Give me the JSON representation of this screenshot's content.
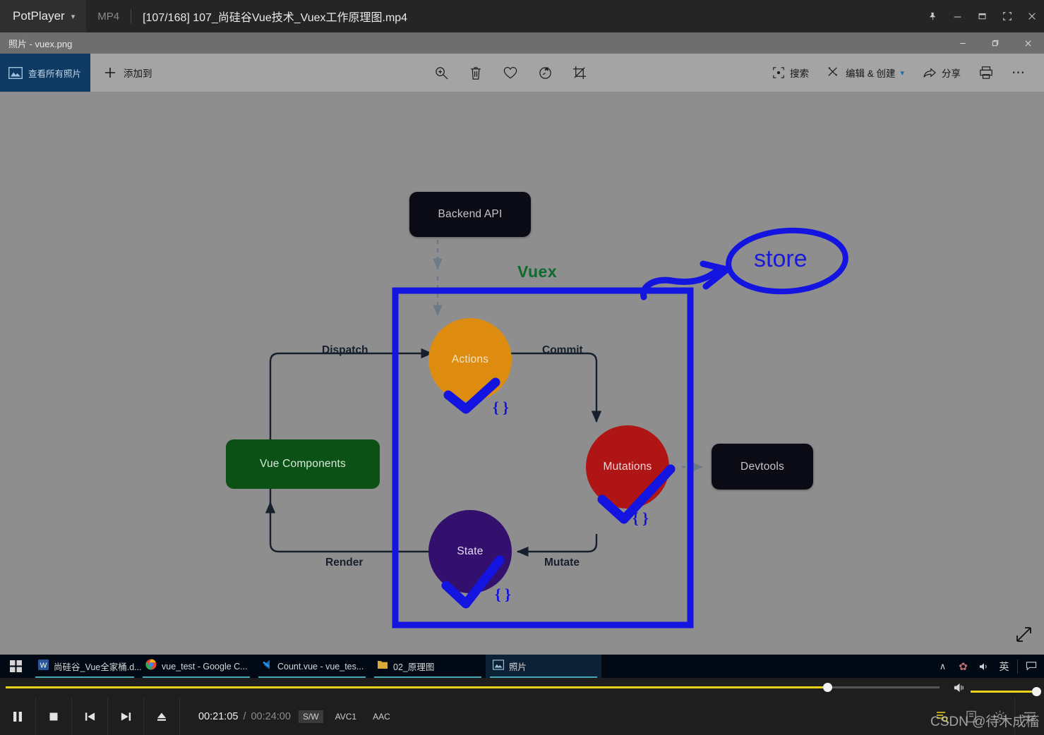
{
  "player": {
    "app_name": "PotPlayer",
    "dropdown_icon": "chevron-down-icon",
    "format": "MP4",
    "file_title": "[107/168] 107_尚硅谷Vue技术_Vuex工作原理图.mp4",
    "window_buttons": [
      {
        "name": "pin-icon",
        "label": "Pin"
      },
      {
        "name": "minimize-icon",
        "label": "Minimize"
      },
      {
        "name": "maximize-icon",
        "label": "Maximize"
      },
      {
        "name": "fullscreen-icon",
        "label": "Fullscreen"
      },
      {
        "name": "close-icon",
        "label": "Close"
      }
    ]
  },
  "photos": {
    "title": "照片 - vuex.png",
    "window_buttons": [
      {
        "name": "minimize-icon",
        "label": "Minimize"
      },
      {
        "name": "restore-icon",
        "label": "Restore"
      },
      {
        "name": "close-icon",
        "label": "Close"
      }
    ],
    "toolbar": {
      "view_all_label": "查看所有照片",
      "view_all_icon": "photo-icon",
      "add_to_label": "添加到",
      "add_to_icon": "plus-icon",
      "center_icons": [
        "zoom-in-icon",
        "delete-icon",
        "heart-icon",
        "rotate-icon",
        "crop-icon"
      ],
      "search_label": "搜索",
      "search_icon": "search-icon",
      "edit_create_label": "编辑 & 创建",
      "edit_create_icon": "edit-icon",
      "edit_create_chevron": "chevron-down-icon",
      "share_label": "分享",
      "share_icon": "share-icon",
      "print_icon": "print-icon",
      "more_icon": "ellipsis-icon"
    },
    "expand_icon": "expand-diagonal-icon"
  },
  "diagram": {
    "title": "Vuex",
    "nodes": [
      {
        "id": "backend",
        "label": "Backend API",
        "shape": "rounded-rect",
        "color": "#0b0b16"
      },
      {
        "id": "vue-components",
        "label": "Vue Components",
        "shape": "rounded-rect",
        "color": "#0b5014"
      },
      {
        "id": "devtools",
        "label": "Devtools",
        "shape": "rounded-rect",
        "color": "#0b0b16"
      },
      {
        "id": "actions",
        "label": "Actions",
        "shape": "circle",
        "color": "#dd8c10"
      },
      {
        "id": "mutations",
        "label": "Mutations",
        "shape": "circle",
        "color": "#b01515"
      },
      {
        "id": "state",
        "label": "State",
        "shape": "circle",
        "color": "#33106e"
      }
    ],
    "edges": [
      {
        "label": "Dispatch",
        "from": "vue-components",
        "to": "actions"
      },
      {
        "label": "Commit",
        "from": "actions",
        "to": "mutations"
      },
      {
        "label": "Mutate",
        "from": "mutations",
        "to": "state"
      },
      {
        "label": "Render",
        "from": "state",
        "to": "vue-components"
      }
    ],
    "annotations": {
      "store_label": "store",
      "brace_actions": "{ }",
      "brace_mutations": "{ }",
      "brace_state": "{ }",
      "ink_color": "#1414e0",
      "checkmarks": [
        "actions",
        "mutations",
        "state"
      ]
    }
  },
  "taskbar": {
    "start_icon": "windows-start-icon",
    "items": [
      {
        "label": "尚硅谷_Vue全家桶.d...",
        "icon": "word-icon",
        "active": false
      },
      {
        "label": "vue_test - Google C...",
        "icon": "chrome-icon",
        "active": false
      },
      {
        "label": "Count.vue - vue_tes...",
        "icon": "vscode-icon",
        "active": false
      },
      {
        "label": "02_原理图",
        "icon": "folder-icon",
        "active": false
      },
      {
        "label": "照片",
        "icon": "photos-icon",
        "active": true
      }
    ],
    "tray": [
      {
        "name": "show-hidden-icons-chevron",
        "glyph": "∧"
      },
      {
        "name": "sogou-input-icon",
        "glyph": "✿"
      },
      {
        "name": "volume-icon",
        "glyph": "🔊"
      },
      {
        "name": "ime-language-icon",
        "glyph": "英"
      },
      {
        "name": "action-center-icon",
        "glyph": "◱"
      }
    ]
  },
  "controls": {
    "seek_percent": 88,
    "volume_percent": 100,
    "buttons": [
      {
        "name": "pause-button",
        "label": "Pause"
      },
      {
        "name": "stop-button",
        "label": "Stop"
      },
      {
        "name": "previous-button",
        "label": "Previous"
      },
      {
        "name": "next-button",
        "label": "Next"
      },
      {
        "name": "eject-button",
        "label": "Eject"
      }
    ],
    "current_time": "00:21:05",
    "separator": "/",
    "total_time": "00:24:00",
    "badges": [
      "S/W",
      "AVC1",
      "AAC"
    ],
    "right_buttons": [
      {
        "name": "playlist-icon",
        "accent": true
      },
      {
        "name": "bookmark-icon",
        "accent": false
      },
      {
        "name": "settings-gear-icon",
        "accent": false
      },
      {
        "name": "menu-icon",
        "accent": false
      }
    ],
    "volume_icon": "speaker-icon"
  },
  "watermark": "CSDN @待木成槒"
}
